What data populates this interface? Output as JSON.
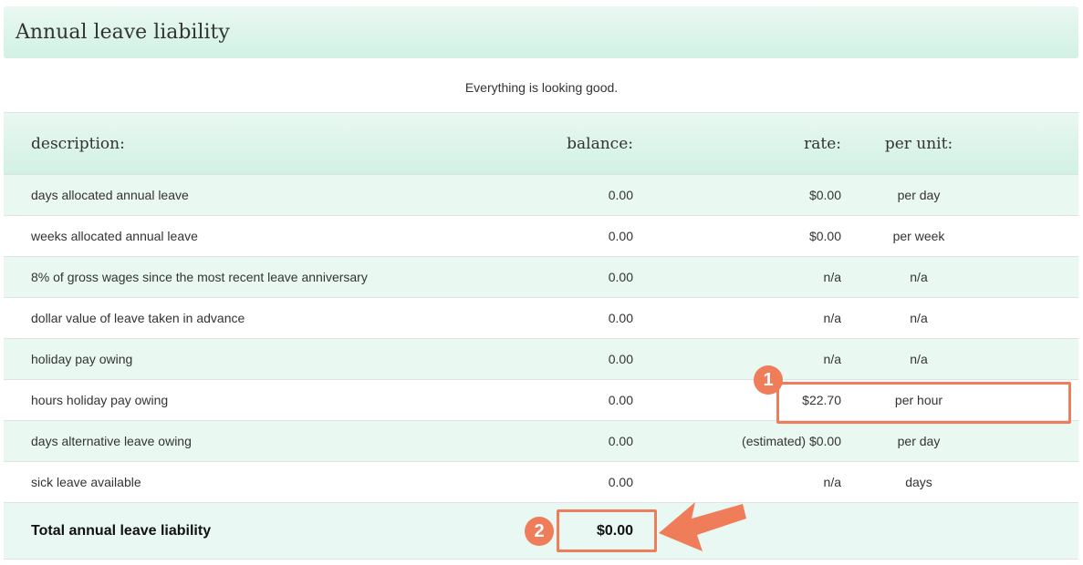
{
  "panel": {
    "title": "Annual leave liability"
  },
  "status": {
    "message": "Everything is looking good."
  },
  "table": {
    "headers": {
      "description": "description:",
      "balance": "balance:",
      "rate": "rate:",
      "per_unit": "per unit:"
    },
    "rows": [
      {
        "description": "days allocated annual leave",
        "balance": "0.00",
        "rate": "$0.00",
        "per_unit": "per day"
      },
      {
        "description": "weeks allocated annual leave",
        "balance": "0.00",
        "rate": "$0.00",
        "per_unit": "per week"
      },
      {
        "description": "8% of gross wages since the most recent leave anniversary",
        "balance": "0.00",
        "rate": "n/a",
        "per_unit": "n/a"
      },
      {
        "description": "dollar value of leave taken in advance",
        "balance": "0.00",
        "rate": "n/a",
        "per_unit": "n/a"
      },
      {
        "description": "holiday pay owing",
        "balance": "0.00",
        "rate": "n/a",
        "per_unit": "n/a"
      },
      {
        "description": "hours holiday pay owing",
        "balance": "0.00",
        "rate": "$22.70",
        "per_unit": "per hour"
      },
      {
        "description": "days alternative leave owing",
        "balance": "0.00",
        "rate": "(estimated) $0.00",
        "per_unit": "per day"
      },
      {
        "description": "sick leave available",
        "balance": "0.00",
        "rate": "n/a",
        "per_unit": "days"
      }
    ],
    "total": {
      "label": "Total annual leave liability",
      "value": "$0.00"
    }
  },
  "annotations": {
    "badge_1": "1",
    "badge_2": "2",
    "color": "#f07d5a"
  },
  "colors": {
    "header_bg": "#d2f1e4",
    "row_alt_bg": "#eaf8f2",
    "accent": "#f07d5a"
  }
}
